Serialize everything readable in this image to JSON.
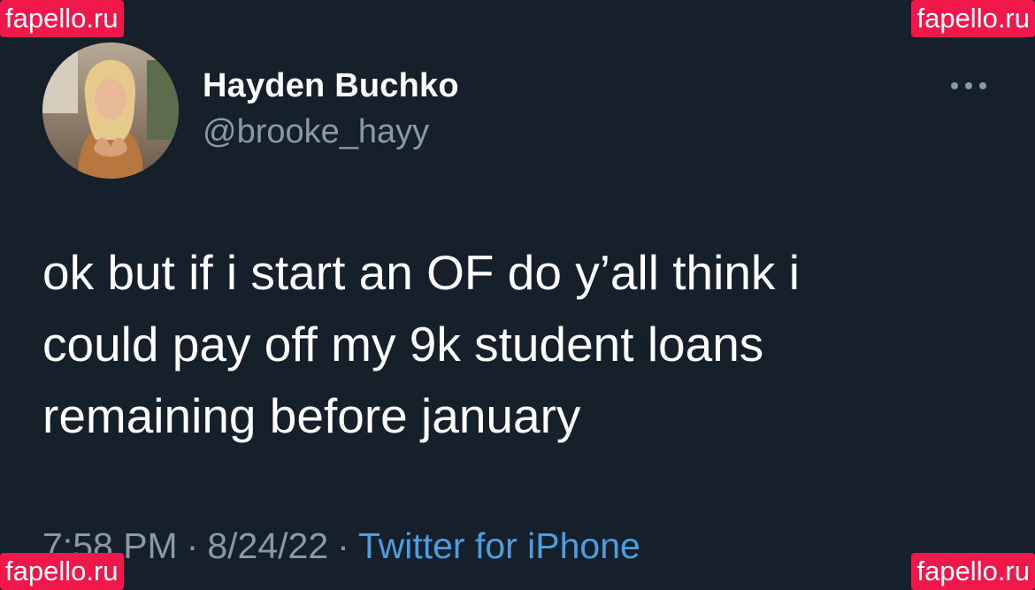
{
  "tweet": {
    "display_name": "Hayden Buchko",
    "handle": "@brooke_hayy",
    "text": "ok but if i start an OF do y’all think i\ncould pay off my 9k student loans\nremaining before january",
    "time": "7:58 PM",
    "date": "8/24/22",
    "separator": "·",
    "source": "Twitter for iPhone",
    "more_icon": "more-horizontal-icon"
  },
  "watermarks": {
    "top_left": "fapello.ru",
    "top_right": "fapello.ru",
    "bottom_left": "fapello.ru",
    "bottom_right": "fapello.ru"
  },
  "colors": {
    "background": "#15202b",
    "text_primary": "#ffffff",
    "text_secondary": "#8b98a5",
    "link": "#4d9de0",
    "watermark": "#f0174b"
  }
}
